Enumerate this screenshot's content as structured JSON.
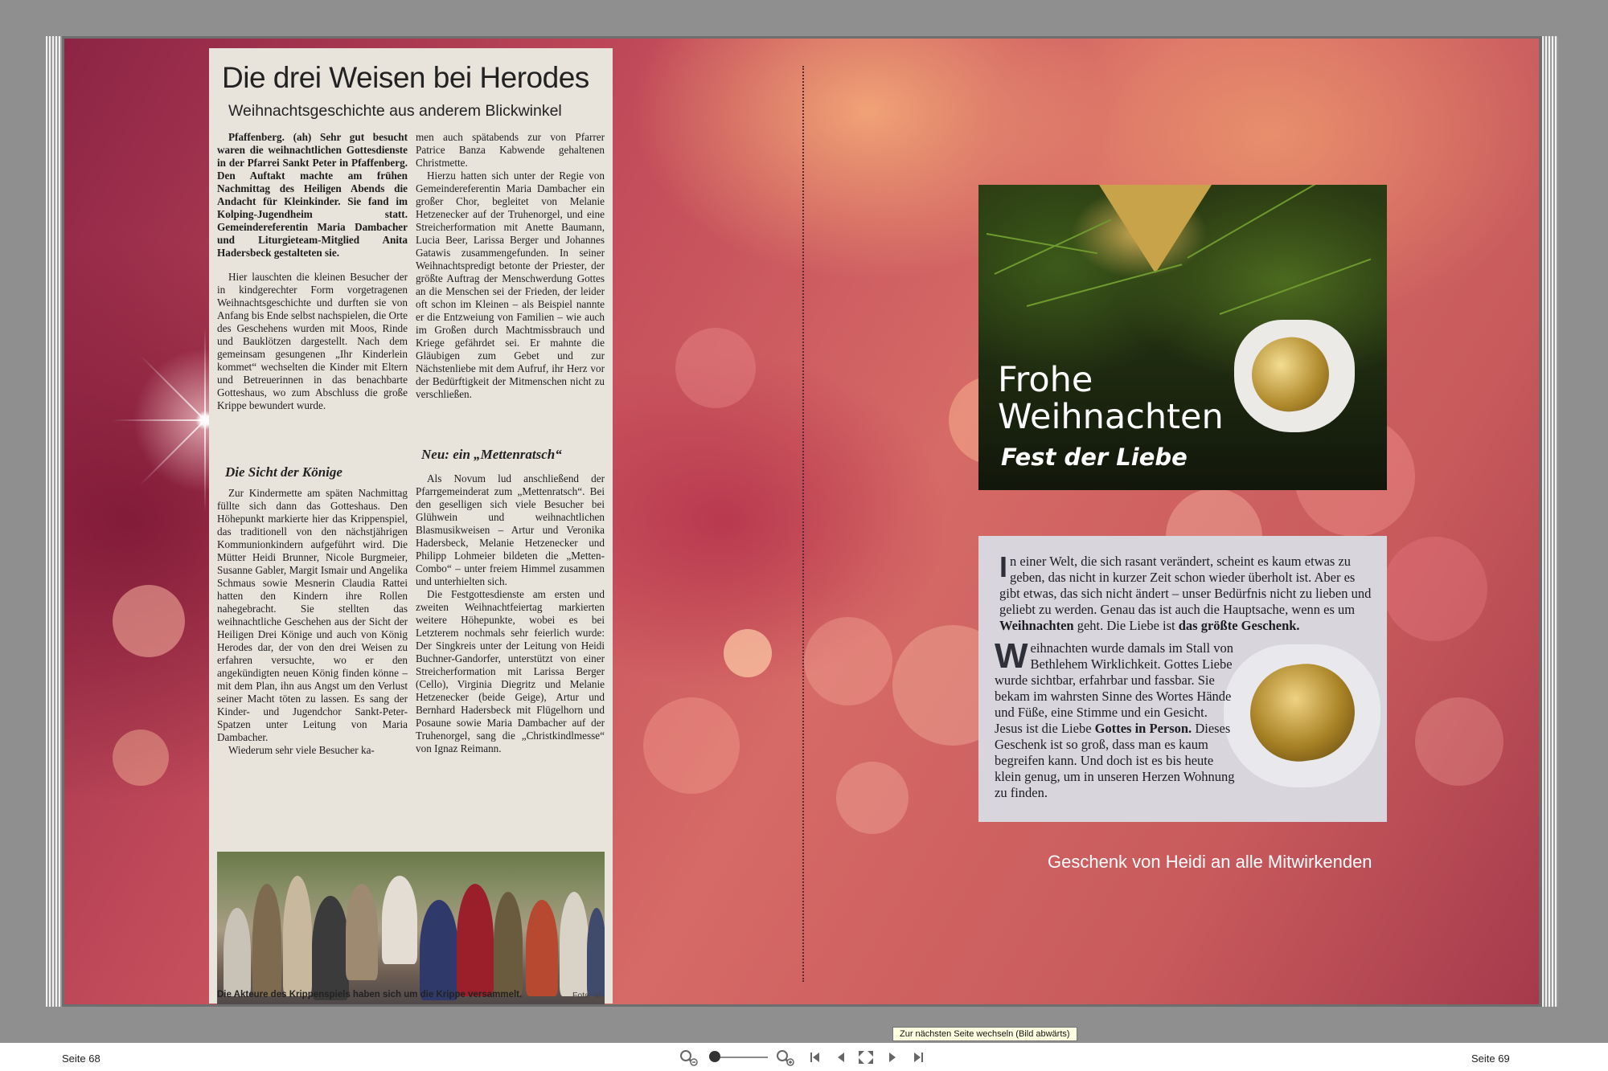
{
  "newspaper": {
    "headline": "Die drei Weisen bei Herodes",
    "subheadline": "Weihnachtsgeschichte aus anderem Blickwinkel",
    "col1_lead": "Pfaffenberg. (ah) Sehr gut besucht waren die weihnachtlichen Gottesdienste in der Pfarrei Sankt Peter in Pfaffenberg. Den Auftakt machte am frühen Nachmittag des Heiligen Abends die Andacht für Kleinkinder. Sie fand im Kolping-Jugendheim statt. Gemeindereferentin Maria Dambacher und Liturgieteam-Mitglied Anita Hadersbeck gestalteten sie.",
    "col1_p2": "Hier lauschten die kleinen Besucher der in kindgerechter Form vorgetragenen Weihnachtsgeschichte und durften sie von Anfang bis Ende selbst nachspielen, die Orte des Geschehens wurden mit Moos, Rinde und Bauklötzen dargestellt. Nach dem gemeinsam gesungenen „Ihr Kinderlein kommet“ wechselten die Kinder mit Eltern und Betreuerinnen in das benachbarte Gotteshaus, wo zum Abschluss die große Krippe bewundert wurde.",
    "col2_p1": "men auch spätabends zur von Pfarrer Patrice Banza Kabwende gehaltenen Christmette.",
    "col2_p2": "Hierzu hatten sich unter der Regie von Gemeindereferentin Maria Dambacher ein großer Chor, begleitet von Melanie Hetzenecker auf der Truhenorgel, und eine Streicherformation mit Anette Baumann, Lucia Beer, Larissa Berger und Johannes Gatawis zusammengefunden. In seiner Weihnachtspredigt betonte der Priester, der größte Auftrag der Menschwerdung Gottes an die Menschen sei der Frieden, der leider oft schon im Kleinen – als Beispiel nannte er die Entzweiung von Familien – wie auch im Großen durch Machtmissbrauch und Kriege gefährdet sei. Er mahnte die Gläubigen zum Gebet und zur Nächstenliebe mit dem Aufruf, ihr Herz vor der Bedürftigkeit der Mitmenschen nicht zu verschließen.",
    "sub1": "Die Sicht der Könige",
    "sub2": "Neu: ein „Mettenratsch“",
    "col3_p1": "Zur Kindermette am späten Nachmittag füllte sich dann das Gotteshaus. Den Höhepunkt markierte hier das Krippenspiel, das traditionell von den nächstjährigen Kommunionkindern aufgeführt wird. Die Mütter Heidi Brunner, Nicole Burgmeier, Susanne Gabler, Margit Ismair und Angelika Schmaus sowie Mesnerin Claudia Rattei hatten den Kindern ihre Rollen nahegebracht. Sie stellten das weihnachtliche Geschehen aus der Sicht der Heiligen Drei Könige und auch von König Herodes dar, der von den drei Weisen zu erfahren versuchte, wo er den angekündigten neuen König finden könne – mit dem Plan, ihn aus Angst um den Verlust seiner Macht töten zu lassen. Es sang der Kinder- und Jugendchor Sankt-Peter-Spatzen unter Leitung von Maria Dambacher.",
    "col3_p2": "Wiederum sehr viele Besucher ka-",
    "col4_p1": "Als Novum lud anschließend der Pfarrgemeinderat zum „Mettenratsch“. Bei den geselligen sich viele Besucher bei Glühwein und weihnachtlichen Blasmusikweisen – Artur und Veronika Hadersbeck, Melanie Hetzenecker und Philipp Lohmeier bildeten die „Metten-Combo“ – unter freiem Himmel zusammen und unterhielten sich.",
    "col4_p2": "Die Festgottesdienste am ersten und zweiten Weihnachtfeiertag markierten weitere Höhepunkte, wobei es bei Letzterem nochmals sehr feierlich wurde: Der Singkreis unter der Leitung von Heidi Buchner-Gandorfer, unterstützt von einer Streicherformation mit Larissa Berger (Cello), Virginia Diegritz und Melanie Hetzenecker (beide Geige), Artur und Bernhard Hadersbeck mit Flügelhorn und Posaune sowie Maria Dambacher auf der Truhenorgel, sang die „Christkindlmesse“ von Ignaz Reimann.",
    "photo_caption": "Die Akteure des Krippenspiels haben sich um die Krippe versammelt.",
    "photo_credit": "Foto: ah"
  },
  "card": {
    "line1": "Frohe",
    "line2": "Weihnachten",
    "line3": "Fest der Liebe"
  },
  "textcard": {
    "cap1": "I",
    "para1_text": "n einer Welt, die sich rasant verändert, scheint es kaum etwas zu geben, das nicht in kurzer Zeit schon wieder überholt ist. Aber es gibt etwas, das sich nicht ändert – unser Bedürfnis nicht zu lieben und geliebt zu werden. Genau das ist auch die Hauptsache, wenn es um ",
    "para1_bold1": "Weihnachten",
    "para1_mid": " geht. Die Liebe ist ",
    "para1_bold2": "das größte Geschenk.",
    "cap2": "W",
    "para2_text": "eihnachten wurde damals im Stall von Bethlehem Wirklichkeit. Gottes Liebe wurde sichtbar, erfahrbar und fassbar. Sie bekam im wahrsten Sinne des Wortes Hände und Füße, eine Stimme und ein Gesicht. Jesus ist die Liebe ",
    "para2_bold": "Gottes in Person.",
    "para2_end": " Dieses Geschenk ist so groß, dass man es kaum begreifen kann. Und doch ist es bis heute klein genug, um in unseren Herzen Wohnung zu finden."
  },
  "gift_caption": "Geschenk von Heidi an alle Mitwirkenden",
  "viewer": {
    "page_left": "Seite 68",
    "page_right": "Seite 69",
    "tooltip": "Zur nächsten Seite wechseln (Bild abwärts)",
    "zoom_level": 0.05,
    "icons": [
      "zoom-out-icon",
      "zoom-in-icon",
      "first-page-icon",
      "prev-page-icon",
      "fit-page-icon",
      "next-page-icon",
      "last-page-icon"
    ]
  },
  "colors": {
    "background": "#8f8f8f",
    "spread_red": "#c24b5a",
    "clipping_paper": "#e8e4dc",
    "tooltip_bg": "#ffffe1"
  }
}
